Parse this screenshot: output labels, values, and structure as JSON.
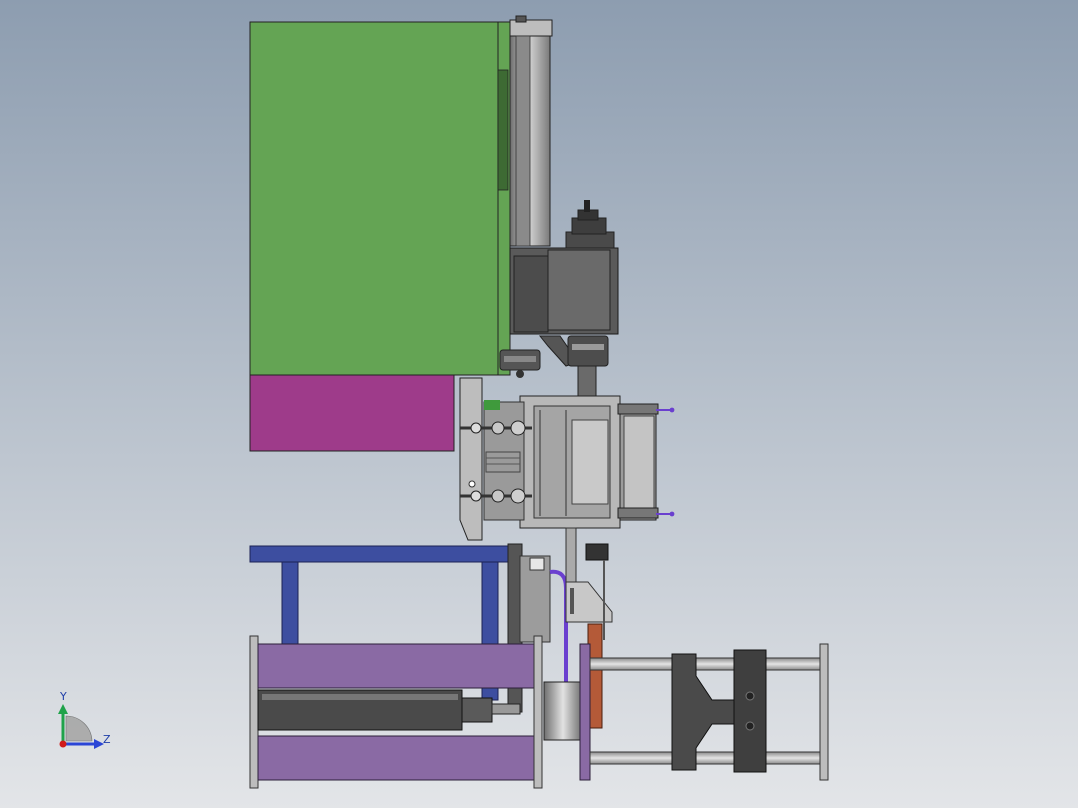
{
  "view": {
    "background_top": "#8d9db0",
    "background_bottom": "#e3e5e8"
  },
  "triad": {
    "y_label": "Y",
    "z_label": "Z",
    "y_axis_color": "#1fa24a",
    "z_axis_color": "#2a45d6",
    "origin_color": "#d11a1a"
  },
  "part_colors": {
    "frame_green": "#64a454",
    "frame_magenta": "#9e3b8a",
    "base_blue": "#3d4ea0",
    "cylinder_purple": "#8a6aa4",
    "steel_gray": "#a7a7a7",
    "dark_gray": "#555555",
    "rust_orange": "#b45a38",
    "hose_violet": "#6a3fcf"
  }
}
